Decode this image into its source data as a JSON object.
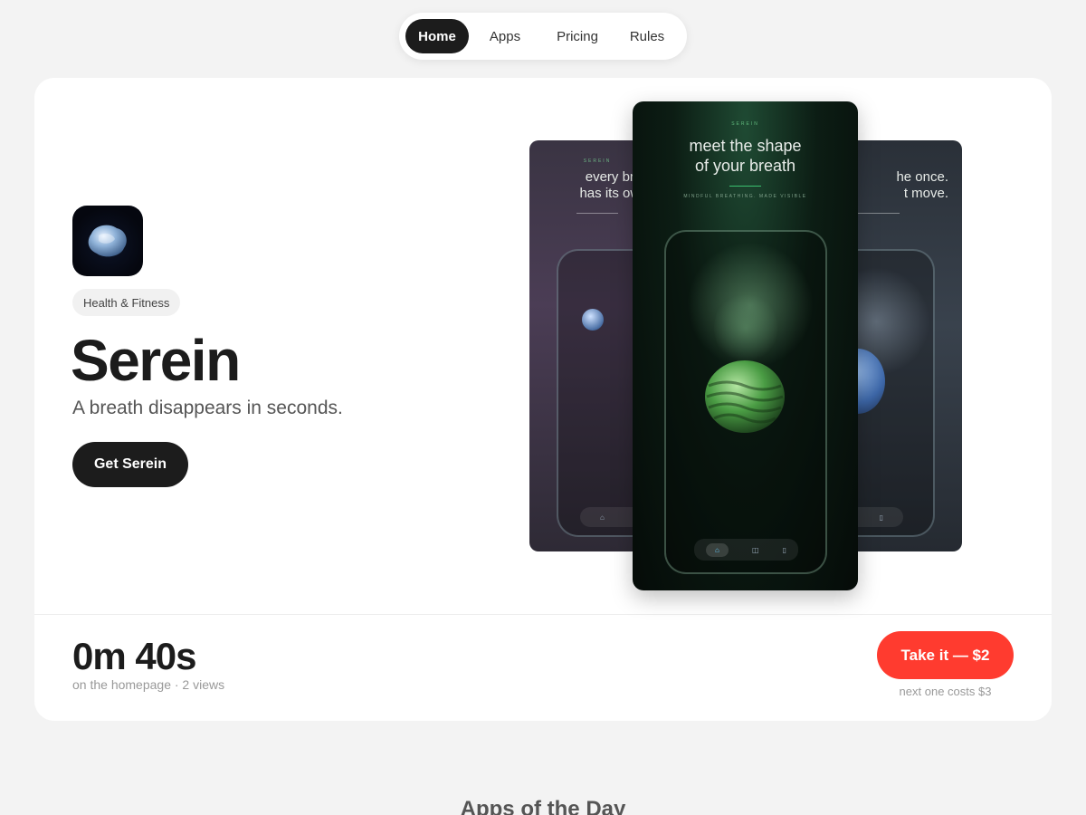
{
  "nav": {
    "items": [
      {
        "label": "Home",
        "active": true
      },
      {
        "label": "Apps",
        "active": false
      },
      {
        "label": "Pricing",
        "active": false
      },
      {
        "label": "Rules",
        "active": false
      }
    ]
  },
  "app": {
    "category": "Health & Fitness",
    "name": "Serein",
    "tagline": "A breath disappears in seconds.",
    "cta_label": "Get Serein",
    "icon": "serein-blob-icon"
  },
  "screenshots": {
    "center": {
      "headline": "meet the shape\nof your breath",
      "sub": "MINDFUL BREATHING. MADE VISIBLE"
    },
    "left": {
      "headline": "every bre\nhas its own"
    },
    "right": {
      "headline": "he once.\nt move."
    }
  },
  "stats": {
    "time": "0m 40s",
    "detail": "on the homepage · 2 views"
  },
  "purchase": {
    "label": "Take it — $2",
    "next_cost": "next one costs $3",
    "accent": "#ff3b2f"
  },
  "section": {
    "heading": "Apps of the Day"
  }
}
